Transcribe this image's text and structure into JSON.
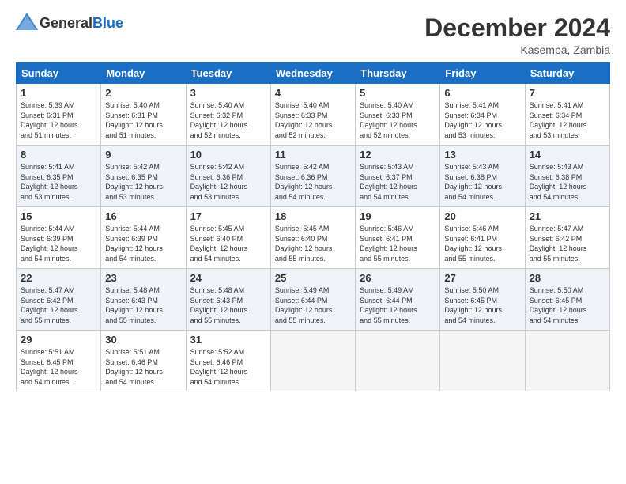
{
  "header": {
    "logo_general": "General",
    "logo_blue": "Blue",
    "month": "December 2024",
    "location": "Kasempa, Zambia"
  },
  "weekdays": [
    "Sunday",
    "Monday",
    "Tuesday",
    "Wednesday",
    "Thursday",
    "Friday",
    "Saturday"
  ],
  "weeks": [
    [
      {
        "day": "1",
        "info": "Sunrise: 5:39 AM\nSunset: 6:31 PM\nDaylight: 12 hours\nand 51 minutes."
      },
      {
        "day": "2",
        "info": "Sunrise: 5:40 AM\nSunset: 6:31 PM\nDaylight: 12 hours\nand 51 minutes."
      },
      {
        "day": "3",
        "info": "Sunrise: 5:40 AM\nSunset: 6:32 PM\nDaylight: 12 hours\nand 52 minutes."
      },
      {
        "day": "4",
        "info": "Sunrise: 5:40 AM\nSunset: 6:33 PM\nDaylight: 12 hours\nand 52 minutes."
      },
      {
        "day": "5",
        "info": "Sunrise: 5:40 AM\nSunset: 6:33 PM\nDaylight: 12 hours\nand 52 minutes."
      },
      {
        "day": "6",
        "info": "Sunrise: 5:41 AM\nSunset: 6:34 PM\nDaylight: 12 hours\nand 53 minutes."
      },
      {
        "day": "7",
        "info": "Sunrise: 5:41 AM\nSunset: 6:34 PM\nDaylight: 12 hours\nand 53 minutes."
      }
    ],
    [
      {
        "day": "8",
        "info": "Sunrise: 5:41 AM\nSunset: 6:35 PM\nDaylight: 12 hours\nand 53 minutes."
      },
      {
        "day": "9",
        "info": "Sunrise: 5:42 AM\nSunset: 6:35 PM\nDaylight: 12 hours\nand 53 minutes."
      },
      {
        "day": "10",
        "info": "Sunrise: 5:42 AM\nSunset: 6:36 PM\nDaylight: 12 hours\nand 53 minutes."
      },
      {
        "day": "11",
        "info": "Sunrise: 5:42 AM\nSunset: 6:36 PM\nDaylight: 12 hours\nand 54 minutes."
      },
      {
        "day": "12",
        "info": "Sunrise: 5:43 AM\nSunset: 6:37 PM\nDaylight: 12 hours\nand 54 minutes."
      },
      {
        "day": "13",
        "info": "Sunrise: 5:43 AM\nSunset: 6:38 PM\nDaylight: 12 hours\nand 54 minutes."
      },
      {
        "day": "14",
        "info": "Sunrise: 5:43 AM\nSunset: 6:38 PM\nDaylight: 12 hours\nand 54 minutes."
      }
    ],
    [
      {
        "day": "15",
        "info": "Sunrise: 5:44 AM\nSunset: 6:39 PM\nDaylight: 12 hours\nand 54 minutes."
      },
      {
        "day": "16",
        "info": "Sunrise: 5:44 AM\nSunset: 6:39 PM\nDaylight: 12 hours\nand 54 minutes."
      },
      {
        "day": "17",
        "info": "Sunrise: 5:45 AM\nSunset: 6:40 PM\nDaylight: 12 hours\nand 54 minutes."
      },
      {
        "day": "18",
        "info": "Sunrise: 5:45 AM\nSunset: 6:40 PM\nDaylight: 12 hours\nand 55 minutes."
      },
      {
        "day": "19",
        "info": "Sunrise: 5:46 AM\nSunset: 6:41 PM\nDaylight: 12 hours\nand 55 minutes."
      },
      {
        "day": "20",
        "info": "Sunrise: 5:46 AM\nSunset: 6:41 PM\nDaylight: 12 hours\nand 55 minutes."
      },
      {
        "day": "21",
        "info": "Sunrise: 5:47 AM\nSunset: 6:42 PM\nDaylight: 12 hours\nand 55 minutes."
      }
    ],
    [
      {
        "day": "22",
        "info": "Sunrise: 5:47 AM\nSunset: 6:42 PM\nDaylight: 12 hours\nand 55 minutes."
      },
      {
        "day": "23",
        "info": "Sunrise: 5:48 AM\nSunset: 6:43 PM\nDaylight: 12 hours\nand 55 minutes."
      },
      {
        "day": "24",
        "info": "Sunrise: 5:48 AM\nSunset: 6:43 PM\nDaylight: 12 hours\nand 55 minutes."
      },
      {
        "day": "25",
        "info": "Sunrise: 5:49 AM\nSunset: 6:44 PM\nDaylight: 12 hours\nand 55 minutes."
      },
      {
        "day": "26",
        "info": "Sunrise: 5:49 AM\nSunset: 6:44 PM\nDaylight: 12 hours\nand 55 minutes."
      },
      {
        "day": "27",
        "info": "Sunrise: 5:50 AM\nSunset: 6:45 PM\nDaylight: 12 hours\nand 54 minutes."
      },
      {
        "day": "28",
        "info": "Sunrise: 5:50 AM\nSunset: 6:45 PM\nDaylight: 12 hours\nand 54 minutes."
      }
    ],
    [
      {
        "day": "29",
        "info": "Sunrise: 5:51 AM\nSunset: 6:45 PM\nDaylight: 12 hours\nand 54 minutes."
      },
      {
        "day": "30",
        "info": "Sunrise: 5:51 AM\nSunset: 6:46 PM\nDaylight: 12 hours\nand 54 minutes."
      },
      {
        "day": "31",
        "info": "Sunrise: 5:52 AM\nSunset: 6:46 PM\nDaylight: 12 hours\nand 54 minutes."
      },
      {
        "day": "",
        "info": ""
      },
      {
        "day": "",
        "info": ""
      },
      {
        "day": "",
        "info": ""
      },
      {
        "day": "",
        "info": ""
      }
    ]
  ]
}
